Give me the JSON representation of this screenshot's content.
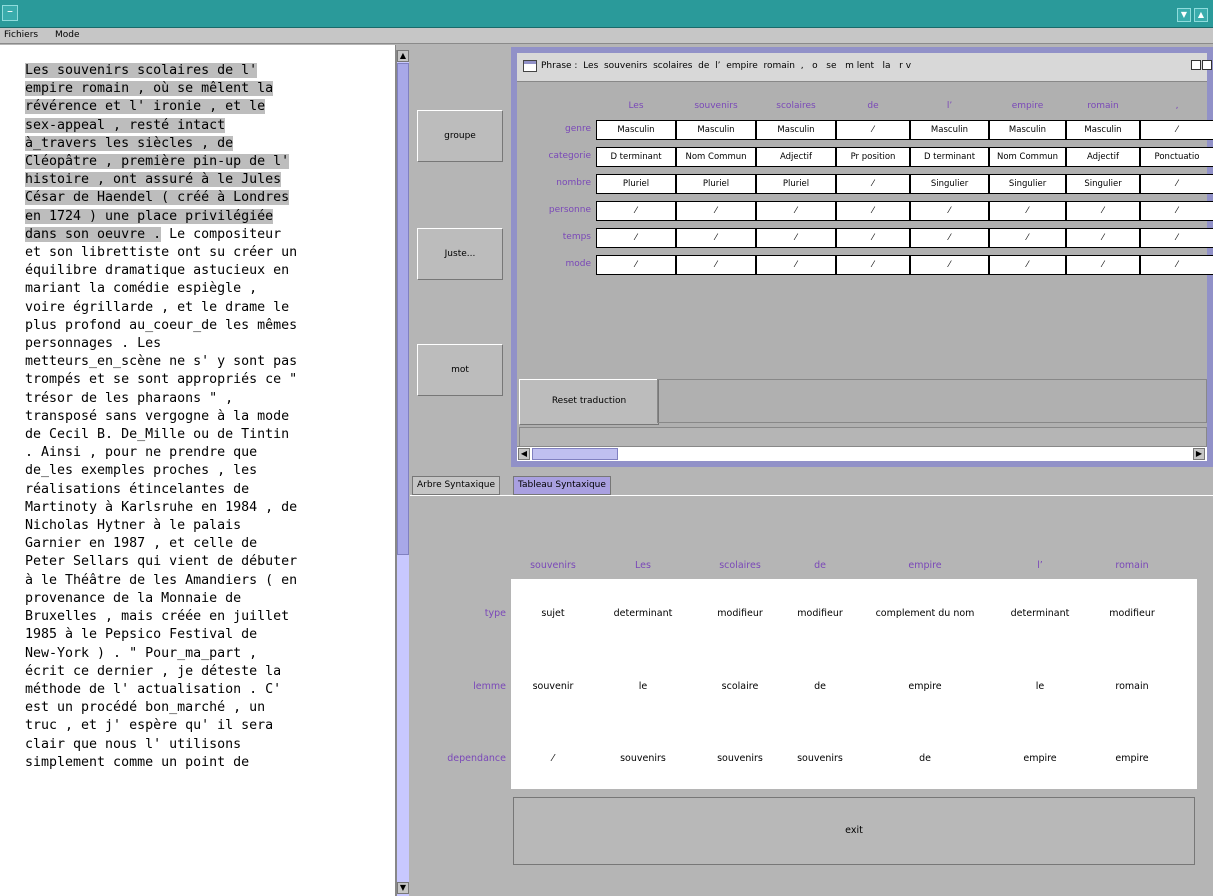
{
  "window": {
    "system_glyph": "–",
    "controls": [
      "▼",
      "▲"
    ]
  },
  "menu": {
    "items": [
      "Fichiers",
      "Mode"
    ]
  },
  "text_pane": {
    "highlighted": "Les souvenirs scolaires de l'\nempire romain , où se mêlent la\nrévérence et l' ironie , et le\nsex-appeal , resté intact\nà_travers les siècles , de\nCléopâtre , première pin-up de l'\nhistoire , ont assuré à le Jules\nCésar de Haendel ( créé à Londres\nen 1724 ) une place privilégiée\ndans son oeuvre .",
    "rest": " Le compositeur\net son librettiste ont su créer un\néquilibre dramatique astucieux en\nmariant la comédie espiègle ,\nvoire égrillarde , et le drame le\nplus profond au_coeur_de les mêmes\npersonnages . Les\nmetteurs_en_scène ne s' y sont pas\ntrompés et se sont appropriés ce \"\ntrésor de les pharaons \" ,\ntransposé sans vergogne à la mode\nde Cecil B. De_Mille ou de Tintin\n. Ainsi , pour ne prendre que\nde_les exemples proches , les\nréalisations étincelantes de\nMartinoty à Karlsruhe en 1984 , de\nNicholas Hytner à le palais\nGarnier en 1987 , et celle de\nPeter Sellars qui vient de débuter\nà le Théâtre de les Amandiers ( en\nprovenance de la Monnaie de\nBruxelles , mais créée en juillet\n1985 à le Pepsico Festival de\nNew-York ) . \" Pour_ma_part ,\nécrit ce dernier , je déteste la\nméthode de l' actualisation . C'\nest un procédé bon_marché , un\ntruc , et j' espère qu' il sera\nclair que nous l' utilisons\nsimplement comme un point de"
  },
  "buttons": {
    "groupe": "groupe",
    "juste": "Juste...",
    "mot": "mot",
    "reset": "Reset traduction",
    "exit": "exit"
  },
  "phrase_window": {
    "label": "Phrase :  Les  souvenirs  scolaires  de  l’  empire  romain  ,   o   se   m lent   la   r v",
    "columns": [
      "Les",
      "souvenirs",
      "scolaires",
      "de",
      "l’",
      "empire",
      "romain",
      ","
    ],
    "rows": [
      {
        "name": "genre",
        "cells": [
          "Masculin",
          "Masculin",
          "Masculin",
          "⁄",
          "Masculin",
          "Masculin",
          "Masculin",
          "⁄"
        ]
      },
      {
        "name": "categorie",
        "cells": [
          "D terminant",
          "Nom Commun",
          "Adjectif",
          "Pr position",
          "D terminant",
          "Nom Commun",
          "Adjectif",
          "Ponctuatio"
        ]
      },
      {
        "name": "nombre",
        "cells": [
          "Pluriel",
          "Pluriel",
          "Pluriel",
          "⁄",
          "Singulier",
          "Singulier",
          "Singulier",
          "⁄"
        ]
      },
      {
        "name": "personne",
        "cells": [
          "⁄",
          "⁄",
          "⁄",
          "⁄",
          "⁄",
          "⁄",
          "⁄",
          "⁄"
        ]
      },
      {
        "name": "temps",
        "cells": [
          "⁄",
          "⁄",
          "⁄",
          "⁄",
          "⁄",
          "⁄",
          "⁄",
          "⁄"
        ]
      },
      {
        "name": "mode",
        "cells": [
          "⁄",
          "⁄",
          "⁄",
          "⁄",
          "⁄",
          "⁄",
          "⁄",
          "⁄"
        ]
      }
    ]
  },
  "tabs": [
    {
      "label": "Arbre Syntaxique",
      "active": false
    },
    {
      "label": "Tableau Syntaxique",
      "active": true
    }
  ],
  "syntax_table": {
    "columns": [
      "souvenirs",
      "Les",
      "scolaires",
      "de",
      "empire",
      "l’",
      "romain"
    ],
    "rows": [
      {
        "name": "type",
        "cells": [
          "sujet",
          "determinant",
          "modifieur",
          "modifieur",
          "complement du nom",
          "determinant",
          "modifieur"
        ]
      },
      {
        "name": "lemme",
        "cells": [
          "souvenir",
          "le",
          "scolaire",
          "de",
          "empire",
          "le",
          "romain"
        ]
      },
      {
        "name": "dependance",
        "cells": [
          "⁄",
          "souvenirs",
          "souvenirs",
          "souvenirs",
          "de",
          "empire",
          "empire"
        ]
      }
    ]
  },
  "colors": {
    "titlebar": "#2a9a9a",
    "window_frame": "#9191c8",
    "label_purple": "#7a48b8",
    "highlight": "#bdbdbd"
  },
  "icons": {
    "scroll_up": "▲",
    "scroll_down": "▼",
    "scroll_left": "◀",
    "scroll_right": "▶"
  }
}
